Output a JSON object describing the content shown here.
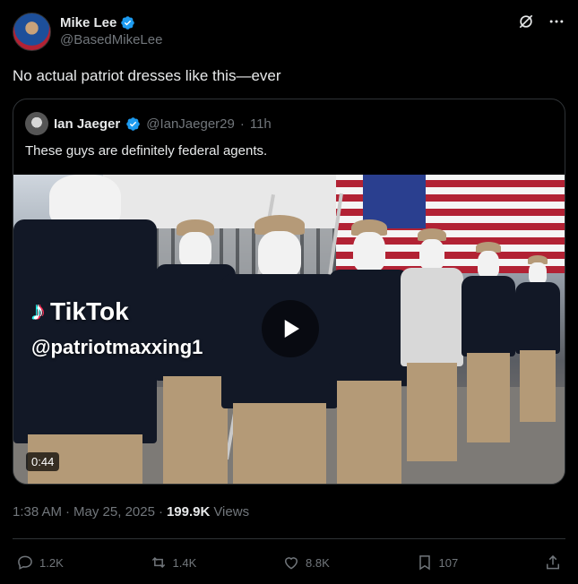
{
  "author": {
    "display_name": "Mike Lee",
    "handle": "@BasedMikeLee",
    "verified": true
  },
  "header_icons": [
    "grok-icon",
    "more-icon"
  ],
  "post_text": "No actual patriot dresses like this—ever",
  "quoted": {
    "display_name": "Ian Jaeger",
    "handle": "@IanJaeger29",
    "separator": "·",
    "time": "11h",
    "verified": true,
    "text": "These guys are definitely federal agents.",
    "video": {
      "watermark_brand": "TikTok",
      "watermark_user": "@patriotmaxxing1",
      "duration": "0:44"
    }
  },
  "meta": {
    "time": "1:38 AM",
    "sep1": "·",
    "date": "May 25, 2025",
    "sep2": "·",
    "views_count": "199.9K",
    "views_label": "Views"
  },
  "actions": {
    "replies": "1.2K",
    "reposts": "1.4K",
    "likes": "8.8K",
    "bookmarks": "107"
  },
  "colors": {
    "background": "#000000",
    "text": "#e7e9ea",
    "muted": "#71767b",
    "border": "#2f3336",
    "verified": "#1d9bf0"
  }
}
